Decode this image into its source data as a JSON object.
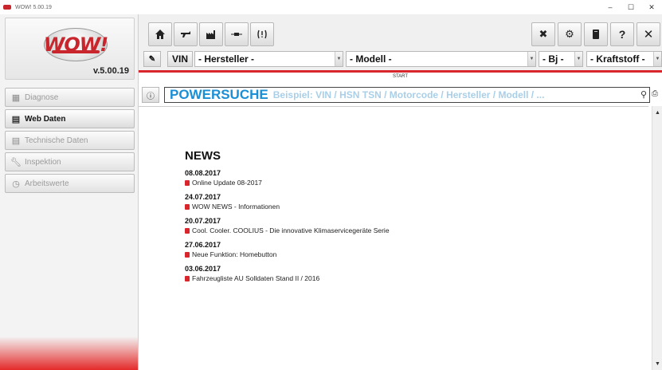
{
  "window": {
    "title": "WOW! 5.00.19",
    "controls": [
      "–",
      "☐",
      "✕"
    ]
  },
  "logo": {
    "text": "WOW!",
    "version": "v.5.00.19"
  },
  "sidebar": {
    "items": [
      {
        "label": "Diagnose",
        "icon": "diagnose-icon"
      },
      {
        "label": "Web Daten",
        "icon": "web-icon"
      },
      {
        "label": "Technische Daten",
        "icon": "tech-icon"
      },
      {
        "label": "Inspektion",
        "icon": "wrench-icon"
      },
      {
        "label": "Arbeitswerte",
        "icon": "clock-icon"
      }
    ]
  },
  "toolbar": {
    "vin_label": "VIN",
    "hersteller": "- Hersteller -",
    "modell": "- Modell -",
    "bj": "- Bj -",
    "kraftstoff": "- Kraftstoff -",
    "close_label": "✖",
    "help_label": "?",
    "exit_label": "✕"
  },
  "content": {
    "start_label": "START",
    "info_label": "ⓘ",
    "search_title": "POWERSUCHE",
    "search_placeholder": "Beispiel: VIN / HSN TSN / Motorcode / Hersteller / Modell / ...",
    "news_title": "NEWS",
    "news": [
      {
        "date": "08.08.2017",
        "text": "Online Update 08-2017"
      },
      {
        "date": "24.07.2017",
        "text": "WOW NEWS - Informationen"
      },
      {
        "date": "20.07.2017",
        "text": "Cool. Cooler. COOLIUS - Die innovative Klimaservicegeräte Serie"
      },
      {
        "date": "27.06.2017",
        "text": "Neue Funktion: Homebutton"
      },
      {
        "date": "03.06.2017",
        "text": "Fahrzeugliste AU Solldaten Stand II / 2016"
      }
    ]
  },
  "colors": {
    "accent": "#d8262c",
    "search_blue": "#1a8fd6"
  }
}
